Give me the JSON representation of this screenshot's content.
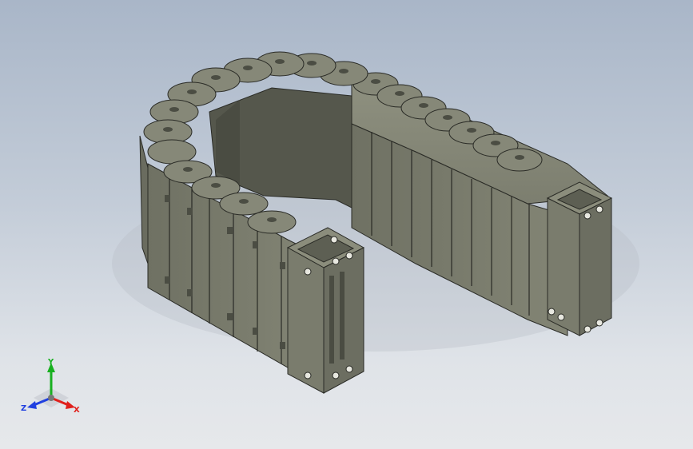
{
  "viewport": {
    "background_top": "#a9b6c8",
    "background_bottom": "#e6e8eb",
    "model": "drag-chain",
    "part_color": "#7b7d6e",
    "edge_color": "#2a2b26"
  },
  "triad": {
    "x_label": "X",
    "y_label": "Y",
    "z_label": "Z",
    "x_color": "#e0201c",
    "y_color": "#18b020",
    "z_color": "#2040e0"
  }
}
